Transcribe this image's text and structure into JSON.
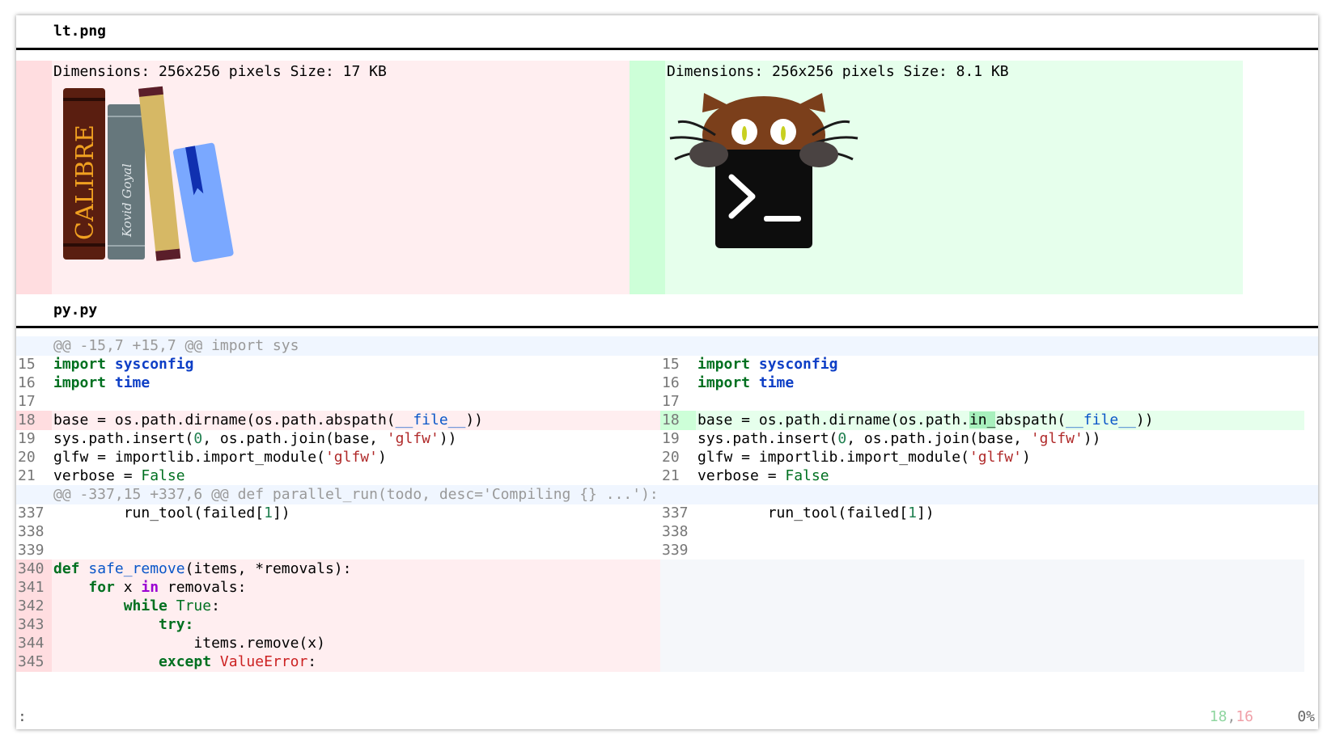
{
  "files": {
    "image_file": "lt.png",
    "code_file": "py.py"
  },
  "images": {
    "left_info": "Dimensions: 256x256 pixels Size: 17 KB",
    "right_info": "Dimensions: 256x256 pixels Size: 8.1 KB",
    "left_logo_text": "CALIBRE",
    "left_logo_author": "Kovid Goyal"
  },
  "diff": {
    "hunk1": "@@ -15,7 +15,7 @@ import sys",
    "hunk2": "@@ -337,15 +337,6 @@ def parallel_run(todo, desc='Compiling {} ...'):",
    "ln": {
      "l15": "15",
      "l16": "16",
      "l17": "17",
      "l18": "18",
      "l19": "19",
      "l20": "20",
      "l21": "21",
      "r15": "15",
      "r16": "16",
      "r17": "17",
      "r18": "18",
      "r19": "19",
      "r20": "20",
      "r21": "21",
      "l337": "337",
      "l338": "338",
      "l339": "339",
      "l340": "340",
      "l341": "341",
      "l342": "342",
      "l343": "343",
      "l344": "344",
      "l345": "345",
      "r337": "337",
      "r338": "338",
      "r339": "339"
    },
    "tok": {
      "import": "import",
      "sysconfig": "sysconfig",
      "time": "time",
      "base_assign": "base = os.path.dirname(os.path.abspath(",
      "base_assign_r1": "base = os.path.dirname(os.path.",
      "in_hl": "in_",
      "base_assign_r2": "abspath(",
      "file_dunder": "__file__",
      "close2": "))",
      "sys_insert": "sys.path.insert(",
      "zero": "0",
      "join": ", os.path.join(base, ",
      "glfw_str": "'glfw'",
      "glfw_assign": "glfw = importlib.import_module(",
      "close1": ")",
      "verbose_assign": "verbose = ",
      "false": "False",
      "run_tool": "        run_tool(failed[",
      "one": "1",
      "close_bracket": "])",
      "def": "def",
      "safe_remove": "safe_remove",
      "safe_args": "(items, *removals):",
      "for": "for",
      "x_var": " x ",
      "in": "in",
      "removals": " removals:",
      "while": "while",
      "true": "True",
      "colon": ":",
      "try": "try:",
      "items_remove": "items.remove(x)",
      "except": "except",
      "value_error": "ValueError",
      "indent4": "    ",
      "indent8": "        ",
      "indent12": "            ",
      "indent16": "                "
    }
  },
  "status": {
    "prompt": ":",
    "pos_added": "18",
    "pos_sep": ",",
    "pos_removed": "16",
    "percent": "0%"
  },
  "colors": {
    "removed_bg": "#ffeef0",
    "added_bg": "#e6ffec",
    "hunk_bg": "#f0f6ff"
  }
}
